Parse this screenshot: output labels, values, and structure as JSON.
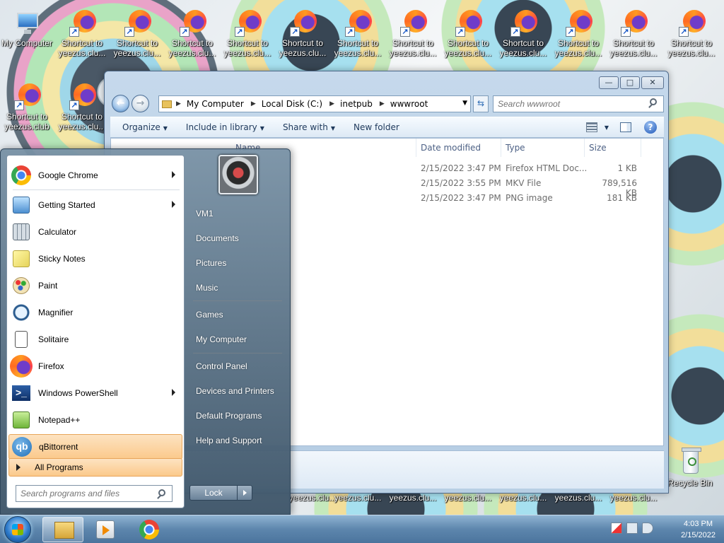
{
  "desktop": {
    "icons": [
      {
        "label": "My Computer",
        "icon": "computer-icon"
      },
      {
        "label": "Shortcut to yeezus.clu...",
        "icon": "firefox-icon"
      },
      {
        "label": "Shortcut to yeezus.clu...",
        "icon": "firefox-icon"
      },
      {
        "label": "Shortcut to yeezus.clu...",
        "icon": "firefox-icon"
      },
      {
        "label": "Shortcut to yeezus.clu...",
        "icon": "firefox-icon"
      },
      {
        "label": "Shortcut to yeezus.clu...",
        "icon": "firefox-icon"
      },
      {
        "label": "Shortcut to yeezus.clu...",
        "icon": "firefox-icon"
      },
      {
        "label": "Shortcut to yeezus.clu...",
        "icon": "firefox-icon"
      },
      {
        "label": "Shortcut to yeezus.clu...",
        "icon": "firefox-icon"
      },
      {
        "label": "Shortcut to yeezus.clu...",
        "icon": "firefox-icon"
      },
      {
        "label": "Shortcut to yeezus.clu...",
        "icon": "firefox-icon"
      },
      {
        "label": "Shortcut to yeezus.clu...",
        "icon": "firefox-icon"
      },
      {
        "label": "Shortcut to yeezus.club",
        "icon": "firefox-icon"
      },
      {
        "label": "Shortcut to yeezus.clu...",
        "icon": "firefox-icon"
      }
    ],
    "bottom_labels": [
      "yeezus.clu...",
      "yeezus.clu...",
      "yeezus.clu...",
      "yeezus.clu...",
      "yeezus.clu...",
      "yeezus.clu...",
      "yeezus.clu..."
    ],
    "recycle_bin": "Recycle Bin"
  },
  "explorer": {
    "caption_buttons": {
      "minimize": "—",
      "maximize": "□",
      "close": "✕"
    },
    "address": [
      "My Computer",
      "Local Disk (C:)",
      "inetpub",
      "wwwroot"
    ],
    "search_placeholder": "Search wwwroot",
    "toolbar": {
      "organize": "Organize",
      "include_in_library": "Include in library",
      "share_with": "Share with",
      "new_folder": "New folder"
    },
    "columns": {
      "name": "Name",
      "date_modified": "Date modified",
      "type": "Type",
      "size": "Size"
    },
    "files": [
      {
        "date": "2/15/2022 3:47 PM",
        "type": "Firefox HTML Doc...",
        "size": "1 KB"
      },
      {
        "date": "2/15/2022 3:55 PM",
        "type": "MKV File",
        "size": "789,516 KB"
      },
      {
        "date": "2/15/2022 3:47 PM",
        "type": "PNG image",
        "size": "181 KB"
      }
    ]
  },
  "start_menu": {
    "programs": [
      {
        "label": "Google Chrome",
        "icon": "chrome-icon",
        "submenu": true
      },
      {
        "label": "Getting Started",
        "icon": "getting-started-icon",
        "submenu": true
      },
      {
        "label": "Calculator",
        "icon": "calculator-icon",
        "submenu": false
      },
      {
        "label": "Sticky Notes",
        "icon": "sticky-notes-icon",
        "submenu": false
      },
      {
        "label": "Paint",
        "icon": "paint-icon",
        "submenu": false
      },
      {
        "label": "Magnifier",
        "icon": "magnifier-icon",
        "submenu": false
      },
      {
        "label": "Solitaire",
        "icon": "solitaire-icon",
        "submenu": false
      },
      {
        "label": "Firefox",
        "icon": "firefox-icon",
        "submenu": false
      },
      {
        "label": "Windows PowerShell",
        "icon": "powershell-icon",
        "submenu": true
      },
      {
        "label": "Notepad++",
        "icon": "notepadpp-icon",
        "submenu": false
      },
      {
        "label": "qBittorrent",
        "icon": "qbittorrent-icon",
        "submenu": false,
        "highlighted": true
      }
    ],
    "all_programs": "All Programs",
    "search_placeholder": "Search programs and files",
    "right_items": [
      {
        "label": "VM1"
      },
      {
        "label": "Documents"
      },
      {
        "label": "Pictures"
      },
      {
        "label": "Music"
      },
      {
        "label": "Games"
      },
      {
        "label": "My Computer"
      },
      {
        "label": "Control Panel"
      },
      {
        "label": "Devices and Printers"
      },
      {
        "label": "Default Programs"
      },
      {
        "label": "Help and Support"
      }
    ],
    "lock_label": "Lock"
  },
  "taskbar": {
    "glyphs": {
      "powershell": ">_",
      "qbittorrent": "qb",
      "help": "?",
      "refresh": "⇆",
      "back": "←",
      "forward": "→"
    },
    "clock_time": "4:03 PM",
    "clock_date": "2/15/2022"
  }
}
